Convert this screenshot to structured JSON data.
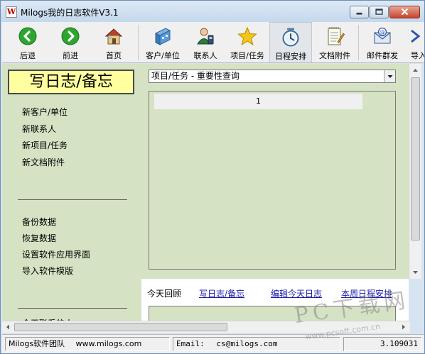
{
  "window": {
    "title": "Milogs我的日志软件V3.1",
    "app_icon_glyph": "W"
  },
  "toolbar": {
    "buttons": [
      {
        "label": "后退",
        "icon": "back-arrow-icon"
      },
      {
        "label": "前进",
        "icon": "forward-arrow-icon"
      },
      {
        "label": "首页",
        "icon": "home-icon"
      },
      {
        "label": "客户/单位",
        "icon": "building-icon"
      },
      {
        "label": "联系人",
        "icon": "contact-person-icon"
      },
      {
        "label": "项目/任务",
        "icon": "star-icon"
      },
      {
        "label": "日程安排",
        "icon": "clock-icon"
      },
      {
        "label": "文档附件",
        "icon": "notepad-icon"
      },
      {
        "label": "邮件群发",
        "icon": "mail-icon"
      },
      {
        "label": "导入",
        "icon": "import-icon"
      }
    ],
    "active_index": 6
  },
  "left_panel": {
    "write_button": "写日志/备忘",
    "links_top": [
      "新客户/单位",
      "新联系人",
      "新项目/任务",
      "新文档附件"
    ],
    "links_bottom": [
      "备份数据",
      "恢复数据",
      "设置软件应用界面",
      "导入软件模版"
    ],
    "links_cut": "今天联系的人"
  },
  "main": {
    "query_select": "项目/任务 - 重要性查询",
    "grid_header": "1"
  },
  "bottom_tabs": {
    "today_review": "今天回顾",
    "write_log": "写日志/备忘",
    "edit_today_log": "编辑今天日志",
    "weekly_schedule": "本周日程安排"
  },
  "status_bar": {
    "team": "Milogs软件团队",
    "site": "www.milogs.com",
    "email_label": "Email:",
    "email": "cs@milogs.com",
    "version": "3.109031"
  },
  "watermark": {
    "text": "PC下载网",
    "url": "www.pcsoft.com.cn"
  },
  "colors": {
    "panel_green": "#d5e3c4",
    "write_button_bg": "#ffff9f",
    "link_blue": "#1a1aa6"
  }
}
